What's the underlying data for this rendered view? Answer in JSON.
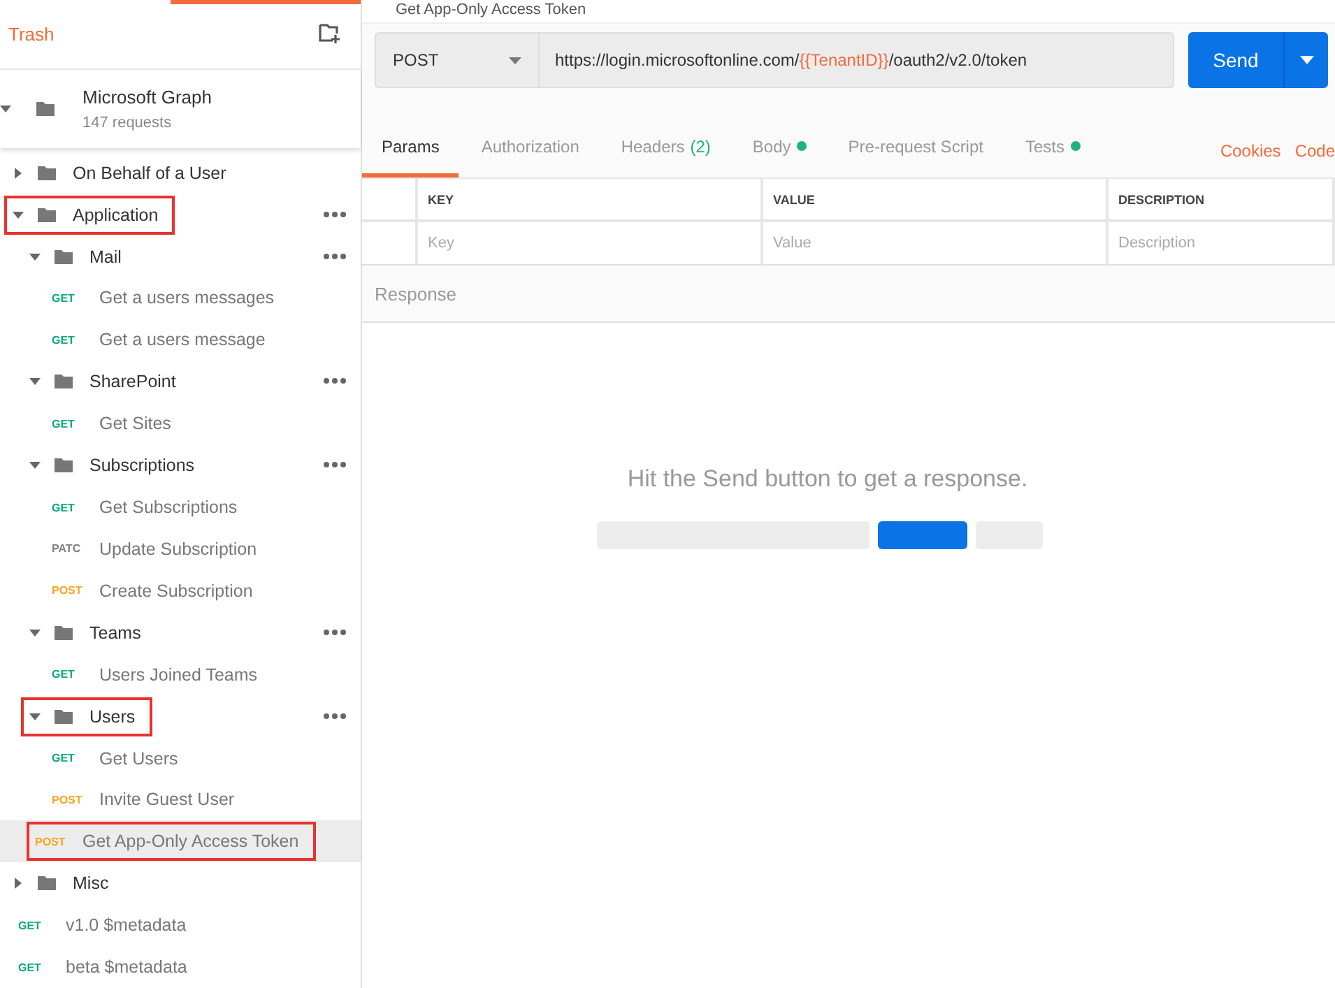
{
  "sidebar": {
    "trash_label": "Trash",
    "collection": {
      "name": "Microsoft Graph",
      "count": "147 requests",
      "expanded": true
    },
    "tree": [
      {
        "kind": "folder",
        "name": "On Behalf of a User",
        "expanded": false
      },
      {
        "kind": "folder",
        "name": "Application",
        "expanded": true,
        "highlighted": true,
        "children": [
          {
            "kind": "folder",
            "name": "Mail",
            "expanded": true,
            "children": [
              {
                "kind": "request",
                "method": "GET",
                "name": "Get a users messages",
                "selected": false
              },
              {
                "kind": "request",
                "method": "GET",
                "name": "Get a users message",
                "selected": false
              }
            ]
          },
          {
            "kind": "folder",
            "name": "SharePoint",
            "expanded": true,
            "children": [
              {
                "kind": "request",
                "method": "GET",
                "name": "Get Sites",
                "selected": false
              }
            ]
          },
          {
            "kind": "folder",
            "name": "Subscriptions",
            "expanded": true,
            "children": [
              {
                "kind": "request",
                "method": "GET",
                "name": "Get Subscriptions",
                "selected": false
              },
              {
                "kind": "request",
                "method": "PATC",
                "name": "Update Subscription",
                "selected": false
              },
              {
                "kind": "request",
                "method": "POST",
                "name": "Create Subscription",
                "selected": false
              }
            ]
          },
          {
            "kind": "folder",
            "name": "Teams",
            "expanded": true,
            "children": [
              {
                "kind": "request",
                "method": "GET",
                "name": "Users Joined Teams",
                "selected": false
              }
            ]
          },
          {
            "kind": "folder",
            "name": "Users",
            "expanded": true,
            "highlighted": true,
            "children": [
              {
                "kind": "request",
                "method": "GET",
                "name": "Get Users",
                "selected": false
              },
              {
                "kind": "request",
                "method": "POST",
                "name": "Invite Guest User",
                "selected": false
              }
            ]
          },
          {
            "kind": "request",
            "method": "POST",
            "name": "Get App-Only Access Token",
            "selected": true,
            "highlighted": true
          }
        ]
      },
      {
        "kind": "folder",
        "name": "Misc",
        "expanded": false
      },
      {
        "kind": "request",
        "method": "GET",
        "name": "v1.0 $metadata",
        "selected": false
      },
      {
        "kind": "request",
        "method": "GET",
        "name": "beta $metadata",
        "selected": false
      }
    ]
  },
  "request": {
    "title": "Get App-Only Access Token",
    "method": "POST",
    "url": "https://login.microsoftonline.com/{{TenantID}}/oauth2/v2.0/token",
    "send_label": "Send"
  },
  "tabs": [
    {
      "label": "Params",
      "selected": true,
      "dot": false
    },
    {
      "label": "Authorization",
      "selected": false,
      "dot": false
    },
    {
      "label": "Headers",
      "selected": false,
      "count": "(2)",
      "dot": false
    },
    {
      "label": "Body",
      "selected": false,
      "dot": true
    },
    {
      "label": "Pre-request Script",
      "selected": false,
      "dot": false
    },
    {
      "label": "Tests",
      "selected": false,
      "dot": true
    }
  ],
  "links": [
    "Cookies",
    "Code"
  ],
  "params_table": {
    "columns": [
      "KEY",
      "VALUE",
      "DESCRIPTION"
    ],
    "placeholders": [
      "Key",
      "Value",
      "Description"
    ]
  },
  "response": {
    "title": "Response",
    "empty_message": "Hit the Send button to get a response."
  }
}
